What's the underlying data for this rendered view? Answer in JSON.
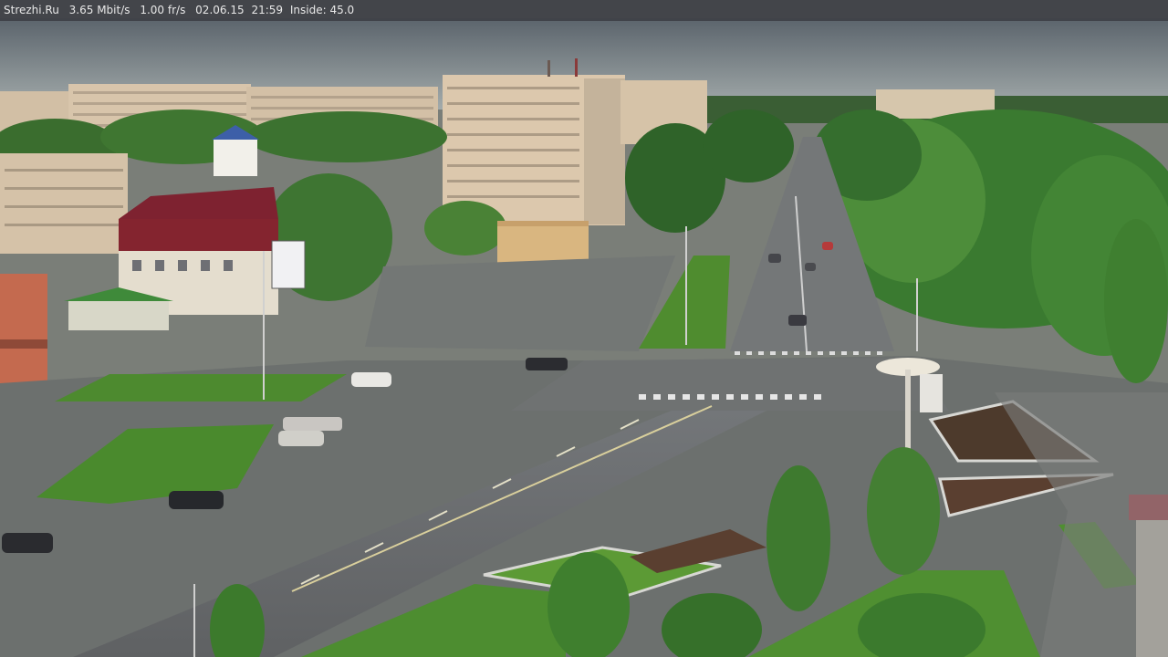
{
  "overlay": {
    "site": "Strezhi.Ru",
    "bitrate": "3.65 Mbit/s",
    "framerate": "1.00 fr/s",
    "date": "02.06.15",
    "time": "21:59",
    "inside": "Inside: 45.0"
  },
  "scene": {
    "description_hidden": "",
    "colors": {
      "sky_top": "#5f6870",
      "sky_bottom": "#9ea7a8",
      "building_beige": "#d9c7ad",
      "building_shadow": "#b6a38a",
      "tree_dark": "#2f6a2a",
      "tree_light": "#5f9a3b",
      "road": "#6b6d6c",
      "road_light": "#7d7f7d",
      "plaza": "#767a78",
      "grass": "#4f8a2e",
      "red_roof": "#8a2430",
      "blue_roof": "#3d5fa8",
      "orange_building": "#c86a4e"
    }
  }
}
